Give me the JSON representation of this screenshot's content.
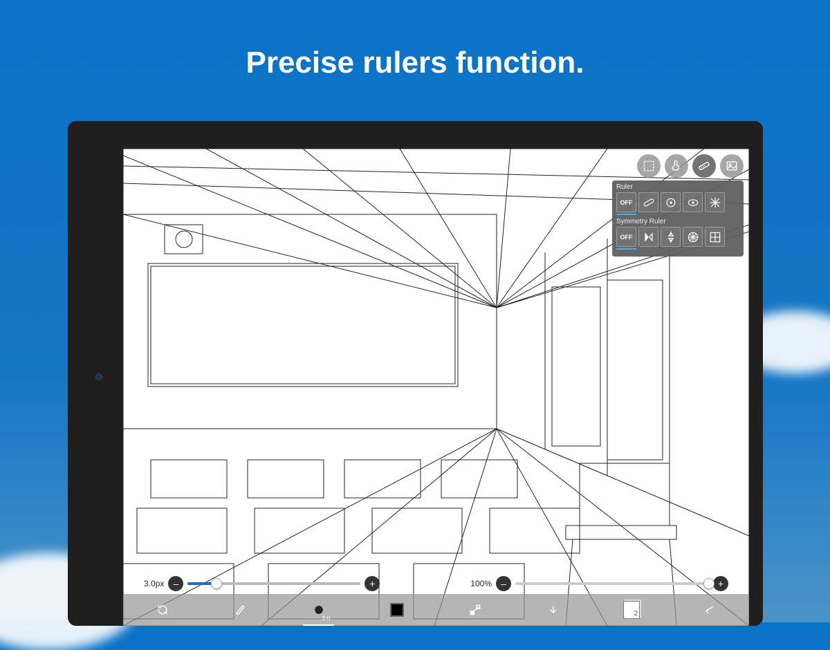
{
  "hero": {
    "title": "Precise rulers function."
  },
  "top_pills": [
    {
      "name": "selection-icon"
    },
    {
      "name": "touch-icon"
    },
    {
      "name": "ruler-icon",
      "active": true
    },
    {
      "name": "image-icon"
    }
  ],
  "popover": {
    "ruler": {
      "label": "Ruler",
      "off_label": "OFF",
      "options": [
        "straight-ruler-icon",
        "circle-ruler-icon",
        "ellipse-ruler-icon",
        "radial-ruler-icon"
      ]
    },
    "symmetry": {
      "label": "Symmetry Ruler",
      "off_label": "OFF",
      "options": [
        "vertical-symmetry-icon",
        "cross-symmetry-icon",
        "kaleidoscope-icon",
        "grid-symmetry-icon"
      ]
    }
  },
  "sliders": {
    "brush_size": {
      "label": "3.0px",
      "minus": "–",
      "plus": "+",
      "fill_pct": 16
    },
    "opacity": {
      "label": "100%",
      "minus": "–",
      "plus": "+",
      "thumb_pct": 100
    }
  },
  "toolbar": {
    "rotate": "rotate-icon",
    "brush": "brush-icon",
    "brush_size_label": "3.0",
    "color": "#000000",
    "gradient": "gradient-icon",
    "import": "import-down-icon",
    "layers_count": "2",
    "back": "back-arrow-icon"
  }
}
